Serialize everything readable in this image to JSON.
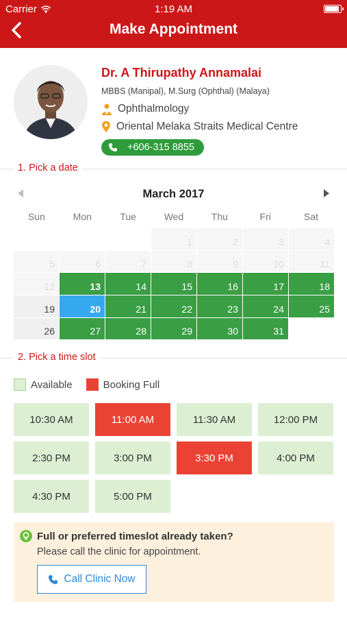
{
  "status_bar": {
    "carrier": "Carrier",
    "time": "1:19 AM"
  },
  "header": {
    "title": "Make Appointment",
    "back_icon": "chevron-left-icon"
  },
  "doctor": {
    "name": "Dr. A Thirupathy Annamalai",
    "qualifications": "MBBS (Manipal), M.Surg (Ophthal) (Malaya)",
    "specialty": "Ophthalmology",
    "location": "Oriental Melaka Straits Medical Centre",
    "phone": "+606-315 8855"
  },
  "sections": {
    "pick_date": "1. Pick a date",
    "pick_time": "2. Pick a time slot"
  },
  "calendar": {
    "month": "March",
    "year": "2017",
    "weekdays": [
      "Sun",
      "Mon",
      "Tue",
      "Wed",
      "Thu",
      "Fri",
      "Sat"
    ],
    "days": [
      {
        "label": "",
        "state": "empty"
      },
      {
        "label": "",
        "state": "empty"
      },
      {
        "label": "",
        "state": "empty"
      },
      {
        "label": "1",
        "state": "disabled"
      },
      {
        "label": "2",
        "state": "disabled"
      },
      {
        "label": "3",
        "state": "disabled"
      },
      {
        "label": "4",
        "state": "disabled"
      },
      {
        "label": "5",
        "state": "disabled"
      },
      {
        "label": "6",
        "state": "disabled"
      },
      {
        "label": "7",
        "state": "disabled"
      },
      {
        "label": "8",
        "state": "disabled"
      },
      {
        "label": "9",
        "state": "disabled"
      },
      {
        "label": "10",
        "state": "disabled"
      },
      {
        "label": "11",
        "state": "disabled"
      },
      {
        "label": "12",
        "state": "disabled"
      },
      {
        "label": "13",
        "state": "avail-bold"
      },
      {
        "label": "14",
        "state": "avail"
      },
      {
        "label": "15",
        "state": "avail"
      },
      {
        "label": "16",
        "state": "avail"
      },
      {
        "label": "17",
        "state": "avail"
      },
      {
        "label": "18",
        "state": "avail"
      },
      {
        "label": "19",
        "state": "normal"
      },
      {
        "label": "20",
        "state": "today"
      },
      {
        "label": "21",
        "state": "avail"
      },
      {
        "label": "22",
        "state": "avail"
      },
      {
        "label": "23",
        "state": "avail"
      },
      {
        "label": "24",
        "state": "avail"
      },
      {
        "label": "25",
        "state": "avail"
      },
      {
        "label": "26",
        "state": "normal"
      },
      {
        "label": "27",
        "state": "avail"
      },
      {
        "label": "28",
        "state": "avail"
      },
      {
        "label": "29",
        "state": "avail"
      },
      {
        "label": "30",
        "state": "avail"
      },
      {
        "label": "31",
        "state": "avail"
      },
      {
        "label": "",
        "state": "empty"
      }
    ]
  },
  "legend": {
    "available": "Available",
    "booking_full": "Booking Full"
  },
  "time_slots": [
    {
      "time": "10:30 AM",
      "status": "available"
    },
    {
      "time": "11:00 AM",
      "status": "full"
    },
    {
      "time": "11:30 AM",
      "status": "available"
    },
    {
      "time": "12:00 PM",
      "status": "available"
    },
    {
      "time": "2:30 PM",
      "status": "available"
    },
    {
      "time": "3:00 PM",
      "status": "available"
    },
    {
      "time": "3:30 PM",
      "status": "full"
    },
    {
      "time": "4:00 PM",
      "status": "available"
    },
    {
      "time": "4:30 PM",
      "status": "available"
    },
    {
      "time": "5:00 PM",
      "status": "available"
    }
  ],
  "info": {
    "question": "Full or preferred timeslot already taken?",
    "message": "Please call the clinic for appointment.",
    "call_button": "Call Clinic Now"
  },
  "colors": {
    "brand_red": "#cc1718",
    "available_green": "#3a9e45",
    "today_blue": "#36a8ef",
    "full_red": "#ea4335"
  }
}
